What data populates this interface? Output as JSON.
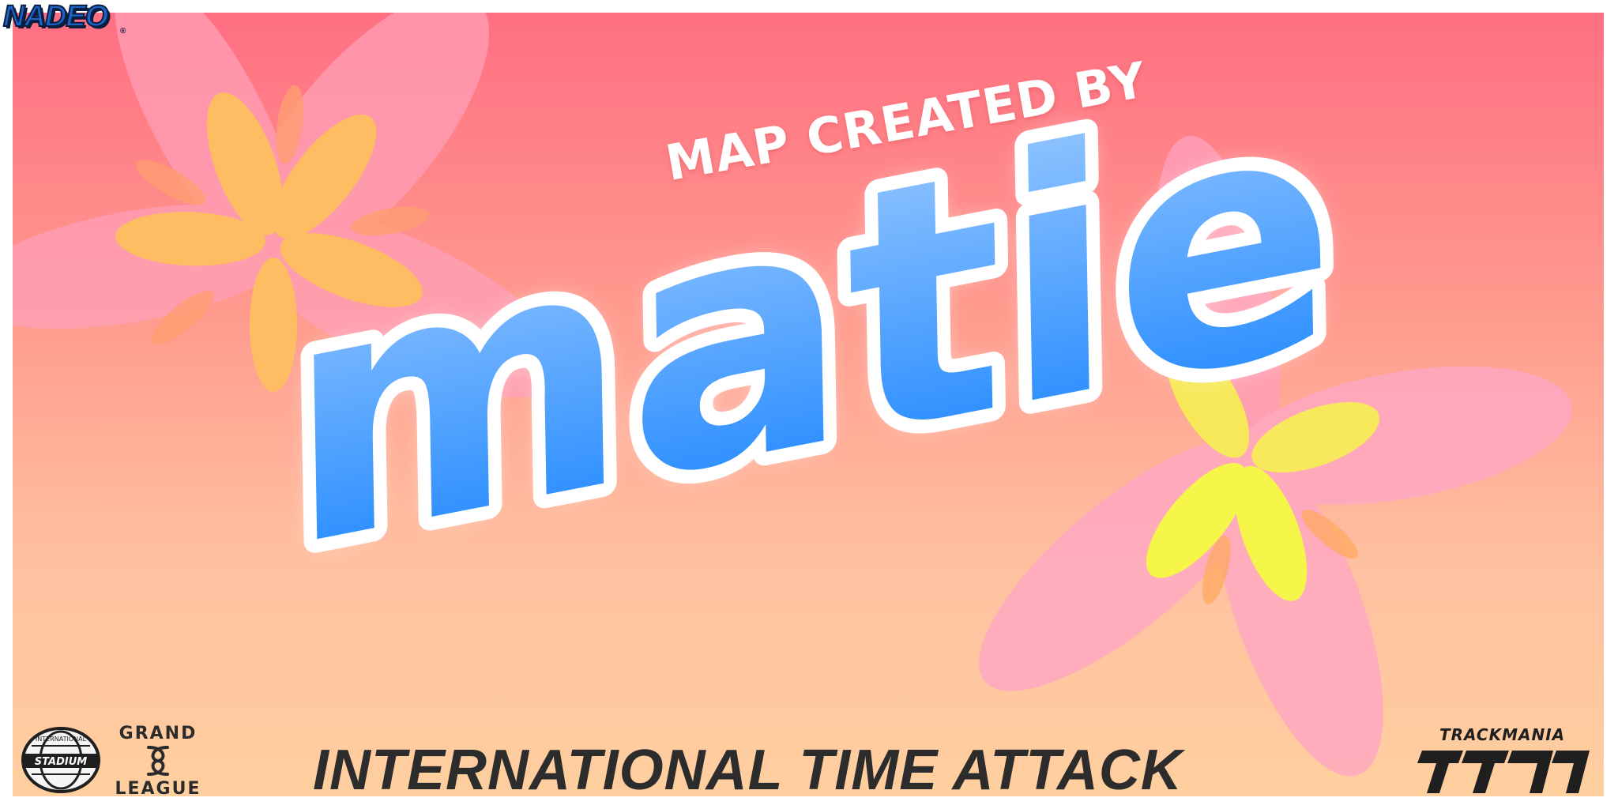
{
  "banner": {
    "publisher_logo": "NADEO",
    "publisher_reg_mark": "®",
    "tagline": "MAP CREATED BY",
    "author_name": "matie",
    "event_title": "INTERNATIONAL TIME ATTACK",
    "logos": {
      "stadium_top_text": "INTERNATIONAL",
      "stadium_main_text": "STADIUM",
      "grand_top": "GRAND",
      "grand_bottom": "LEAGUE",
      "trackmania_text": "TRACKMANIA"
    },
    "icons": [
      "stadium-globe-icon",
      "grand-league-knot-icon",
      "tm-logo-icon",
      "flower-decor-icon"
    ]
  },
  "colors": {
    "background_top": "#ff6f82",
    "background_bottom": "#ffcf9f",
    "name_fill_top": "#8ec3ff",
    "name_fill_bottom": "#1a85ff",
    "name_outline": "#ffffff",
    "title_color": "#2c2c2c",
    "petal_pink": "#ff9fb8",
    "petal_orange": "#ffb860",
    "petal_yellow": "#f6f54a"
  }
}
